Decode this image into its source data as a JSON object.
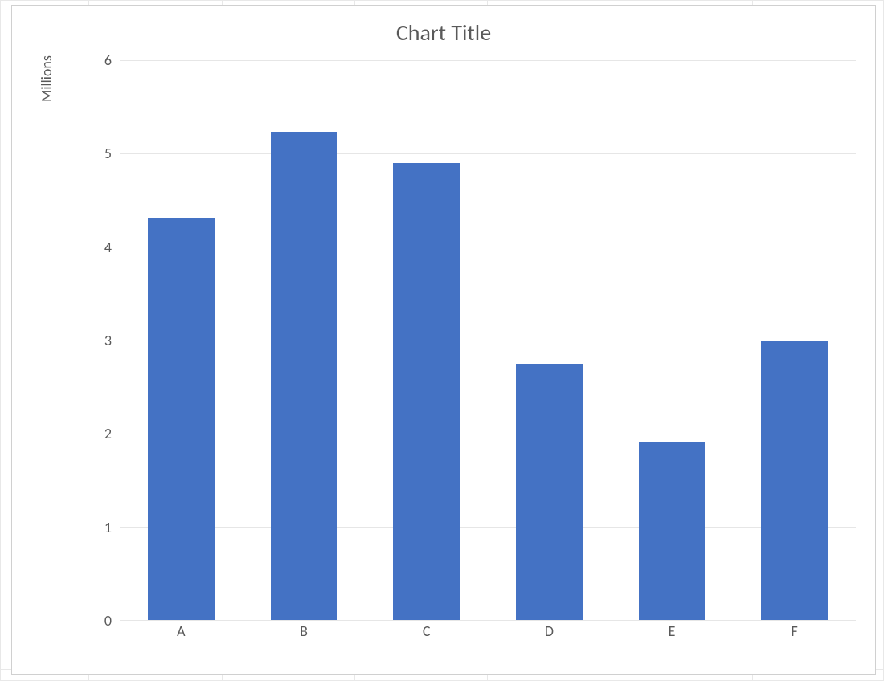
{
  "chart_data": {
    "type": "bar",
    "title": "Chart Title",
    "axis_unit_label": "Millions",
    "categories": [
      "A",
      "B",
      "C",
      "D",
      "E",
      "F"
    ],
    "values": [
      4.3,
      5.23,
      4.9,
      2.75,
      1.9,
      3.0
    ],
    "ylim": [
      0,
      6
    ],
    "yticks": [
      0,
      1,
      2,
      3,
      4,
      5,
      6
    ],
    "bar_color": "#4472c4"
  }
}
